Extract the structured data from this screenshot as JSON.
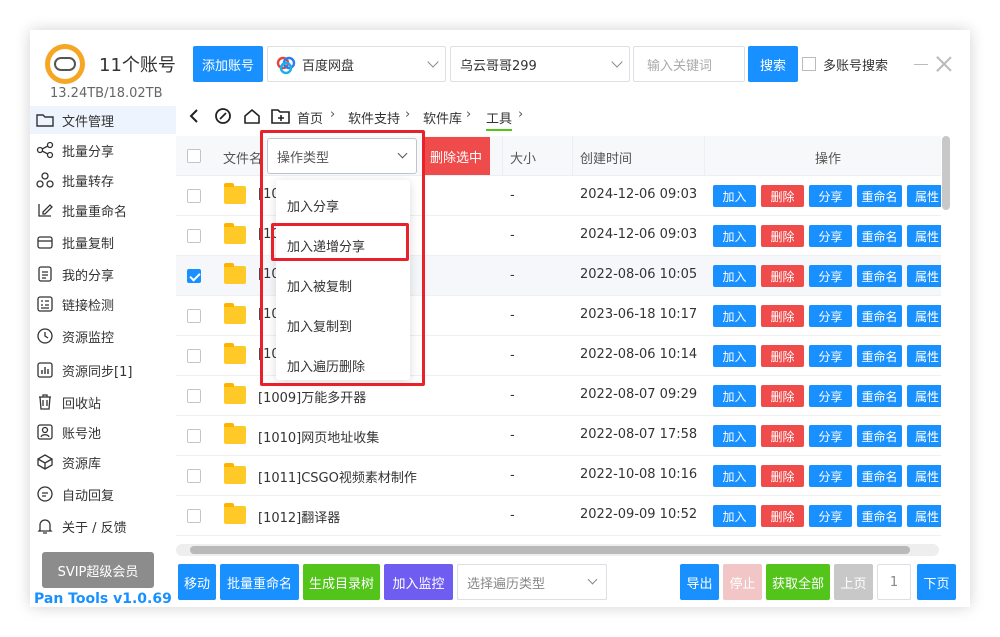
{
  "header": {
    "app_title": "11个账号",
    "storage": "13.24TB/18.02TB",
    "add_account": "添加账号",
    "disk_select": "百度网盘",
    "user_select": "乌云哥哥299",
    "search_placeholder": "输入关键词",
    "search_button": "搜索",
    "multi_search": "多账号搜索"
  },
  "sidebar": {
    "items": [
      {
        "label": "文件管理",
        "icon": "folder-icon"
      },
      {
        "label": "批量分享",
        "icon": "share-icon"
      },
      {
        "label": "批量转存",
        "icon": "transfer-icon"
      },
      {
        "label": "批量重命名",
        "icon": "rename-icon"
      },
      {
        "label": "批量复制",
        "icon": "copy-icon"
      },
      {
        "label": "我的分享",
        "icon": "my-share-icon"
      },
      {
        "label": "链接检测",
        "icon": "link-check-icon"
      },
      {
        "label": "资源监控",
        "icon": "monitor-icon"
      },
      {
        "label": "资源同步[1]",
        "icon": "sync-icon"
      },
      {
        "label": "回收站",
        "icon": "trash-icon"
      },
      {
        "label": "账号池",
        "icon": "account-pool-icon"
      },
      {
        "label": "资源库",
        "icon": "library-icon"
      },
      {
        "label": "自动回复",
        "icon": "auto-reply-icon"
      },
      {
        "label": "关于 / 反馈",
        "icon": "bell-icon"
      }
    ],
    "svip": "SVIP超级会员",
    "version": "Pan Tools v1.0.69"
  },
  "breadcrumb": [
    "首页",
    "软件支持",
    "软件库",
    "工具"
  ],
  "table": {
    "headers": {
      "name": "文件名",
      "size": "大小",
      "created": "创建时间",
      "ops": "操作"
    },
    "action_type_placeholder": "操作类型",
    "delete_selected": "删除选中",
    "op_labels": [
      "加入",
      "删除",
      "分享",
      "重命名",
      "属性"
    ],
    "rows": [
      {
        "name": "[10",
        "size": "-",
        "date": "2024-12-06 09:03",
        "checked": false
      },
      {
        "name": "[10",
        "size": "-",
        "date": "2024-12-06 09:03",
        "checked": false
      },
      {
        "name": "[10",
        "size": "-",
        "date": "2022-08-06 10:05",
        "checked": true
      },
      {
        "name": "[10",
        "size": "-",
        "date": "2023-06-18 10:17",
        "checked": false
      },
      {
        "name": "[10",
        "size": "-",
        "date": "2022-08-06 10:14",
        "checked": false
      },
      {
        "name": "[1009]万能多开器",
        "size": "-",
        "date": "2022-08-07 09:29",
        "checked": false
      },
      {
        "name": "[1010]网页地址收集",
        "size": "-",
        "date": "2022-08-07 17:58",
        "checked": false
      },
      {
        "name": "[1011]CSGO视频素材制作",
        "size": "-",
        "date": "2022-10-08 10:16",
        "checked": false
      },
      {
        "name": "[1012]翻译器",
        "size": "-",
        "date": "2022-09-09 10:52",
        "checked": false
      }
    ]
  },
  "dropdown": {
    "items": [
      "加入分享",
      "加入递增分享",
      "加入被复制",
      "加入复制到",
      "加入遍历删除"
    ]
  },
  "bottom": {
    "move": "移动",
    "batch_rename": "批量重命名",
    "gen_tree": "生成目录树",
    "add_monitor": "加入监控",
    "traverse_placeholder": "选择遍历类型",
    "export": "导出",
    "stop": "停止",
    "fetch_all": "获取全部",
    "prev": "上页",
    "page": "1",
    "next": "下页"
  },
  "colors": {
    "primary": "#1890ff",
    "danger": "#f04b4b",
    "success": "#52c41a",
    "purple": "#6f5cf1",
    "highlight": "#e8212b"
  }
}
